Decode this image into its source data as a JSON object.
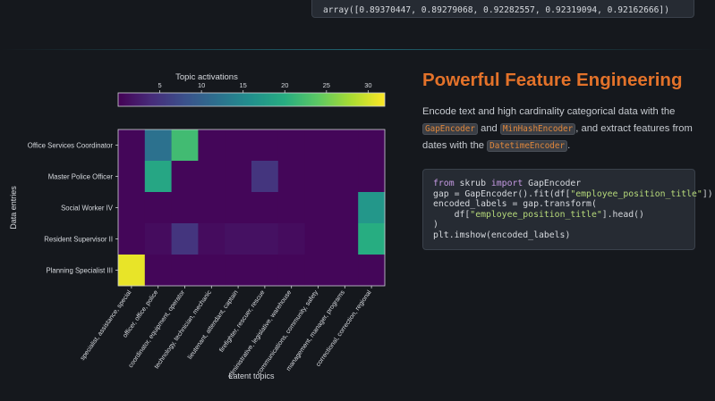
{
  "top_output": "array([0.89370447, 0.89279068, 0.92282557, 0.92319094, 0.92162666])",
  "heading": "Powerful Feature Engineering",
  "description": {
    "part1": "Encode text and high cardinality categorical data with the ",
    "kw1": "GapEncoder",
    "part2": " and ",
    "kw2": "MinHashEncoder",
    "part3": ", and extract features from dates with the ",
    "kw3": "DatetimeEncoder",
    "part4": "."
  },
  "code": {
    "line1_from": "from",
    "line1_mod": " skrub ",
    "line1_import": "import",
    "line1_name": " GapEncoder",
    "line2_a": "gap = GapEncoder().fit(df[",
    "line2_str": "\"employee_position_title\"",
    "line2_b": "])",
    "line3": "encoded_labels = gap.transform(",
    "line4_a": "    df[",
    "line4_str": "\"employee_position_title\"",
    "line4_b": "].head()",
    "line5": ")",
    "line6": "plt.imshow(encoded_labels)"
  },
  "chart_data": {
    "type": "heatmap",
    "colorbar_title": "Topic activations",
    "colorbar_ticks": [
      5,
      10,
      15,
      20,
      25,
      30
    ],
    "colorbar_range": [
      0,
      32
    ],
    "colormap": "viridis",
    "ylabel": "Data entries",
    "xlabel": "Latent topics",
    "rows": [
      "Office Services Coordinator",
      "Master Police Officer",
      "Social Worker IV",
      "Resident Supervisor II",
      "Planning Specialist III"
    ],
    "columns": [
      "specialist, assistance, special",
      "officer, office, police",
      "coordinator, equipment, operator",
      "technology, technician, mechanic",
      "lieutenant, attendant, captain",
      "firefighter, rescuer, rescue",
      "administrative, legislative, warehouse",
      "communications, community, safety",
      "management, manager, programs",
      "correctional, correction, regional"
    ],
    "values": [
      [
        0.5,
        12,
        22,
        0.5,
        0.5,
        0.5,
        0.5,
        0.5,
        0.5,
        0.5
      ],
      [
        0.5,
        19,
        0.5,
        0.5,
        0.5,
        5,
        0.5,
        0.5,
        0.5,
        0.5
      ],
      [
        0.5,
        0.5,
        0.5,
        0.5,
        0.5,
        0.5,
        0.5,
        0.5,
        0.5,
        17
      ],
      [
        0.5,
        1,
        5,
        1,
        1.5,
        1.5,
        1,
        0.5,
        0.5,
        20
      ],
      [
        31,
        0.5,
        0.5,
        0.5,
        0.5,
        0.5,
        0.5,
        0.5,
        0.5,
        0.5
      ]
    ]
  }
}
